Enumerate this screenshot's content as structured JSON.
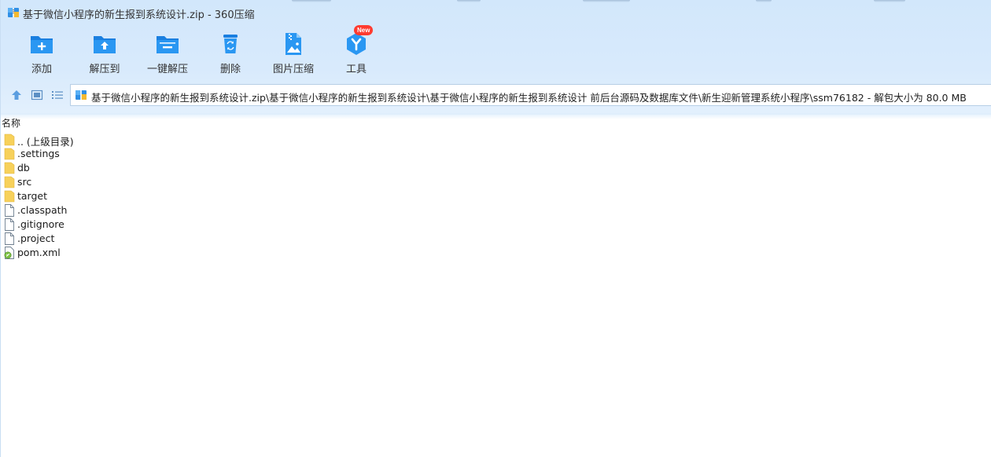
{
  "window": {
    "title": "基于微信小程序的新生报到系统设计.zip - 360压缩"
  },
  "toolbar": {
    "buttons": [
      {
        "label": "添加",
        "icon": "folder-add-icon"
      },
      {
        "label": "解压到",
        "icon": "folder-extract-icon"
      },
      {
        "label": "一键解压",
        "icon": "folder-one-click-extract-icon"
      },
      {
        "label": "删除",
        "icon": "recycle-bin-icon"
      },
      {
        "label": "图片压缩",
        "icon": "image-compress-icon"
      },
      {
        "label": "工具",
        "icon": "tools-icon",
        "badge": "New"
      }
    ]
  },
  "addressbar": {
    "path": "基于微信小程序的新生报到系统设计.zip\\基于微信小程序的新生报到系统设计\\基于微信小程序的新生报到系统设计 前后台源码及数据库文件\\新生迎新管理系统小程序\\ssm76182 - 解包大小为 80.0 MB",
    "nav_icons": [
      "up-arrow-icon",
      "preview-view-icon",
      "list-view-icon"
    ]
  },
  "filelist": {
    "column_header": "名称",
    "items": [
      {
        "name": ".. (上级目录)",
        "type": "folder"
      },
      {
        "name": ".settings",
        "type": "folder"
      },
      {
        "name": "db",
        "type": "folder"
      },
      {
        "name": "src",
        "type": "folder"
      },
      {
        "name": "target",
        "type": "folder"
      },
      {
        "name": ".classpath",
        "type": "file"
      },
      {
        "name": ".gitignore",
        "type": "file"
      },
      {
        "name": ".project",
        "type": "file"
      },
      {
        "name": "pom.xml",
        "type": "xml-file"
      }
    ]
  },
  "colors": {
    "accent": "#1e8ae6",
    "toolbar_bg": "#d6e9fc",
    "folder": "#f7d15b",
    "badge": "#ff3b30"
  }
}
